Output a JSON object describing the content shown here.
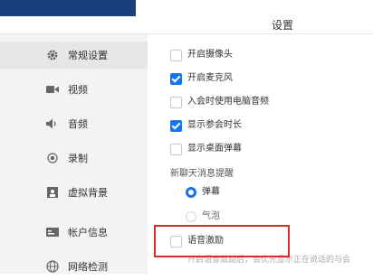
{
  "window": {
    "title": "设置"
  },
  "sidebar": {
    "items": [
      {
        "label": "常规设置",
        "icon": "gear-icon",
        "active": true
      },
      {
        "label": "视频",
        "icon": "video-camera-icon",
        "active": false
      },
      {
        "label": "音频",
        "icon": "speaker-icon",
        "active": false
      },
      {
        "label": "录制",
        "icon": "record-icon",
        "active": false
      },
      {
        "label": "虚拟背景",
        "icon": "portrait-icon",
        "active": false
      },
      {
        "label": "帐户信息",
        "icon": "id-card-icon",
        "active": false
      },
      {
        "label": "网络检测",
        "icon": "globe-icon",
        "active": false
      }
    ]
  },
  "general": {
    "options": [
      {
        "label": "开启摄像头",
        "checked": false
      },
      {
        "label": "开启麦克风",
        "checked": true
      },
      {
        "label": "入会时使用电脑音频",
        "checked": false
      },
      {
        "label": "显示参会时长",
        "checked": true
      },
      {
        "label": "显示桌面弹幕",
        "checked": false
      }
    ],
    "chat_reminder": {
      "label": "新聊天消息提醒",
      "choices": [
        {
          "label": "弹幕",
          "selected": true
        },
        {
          "label": "气泡",
          "selected": false
        }
      ]
    },
    "voice_stimulus": {
      "label": "语音激励",
      "checked": false,
      "description": "开启语音激励后，会优先显示正在说话的与会"
    }
  },
  "colors": {
    "accent": "#1a73e8",
    "highlight": "#d32f2f",
    "sidebar_bg": "#f3f3f3"
  }
}
